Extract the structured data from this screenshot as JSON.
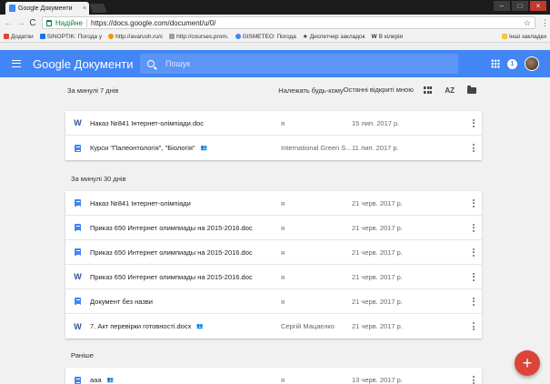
{
  "browser": {
    "tab_title": "Google Документи",
    "tab_close": "×",
    "window_controls": [
      "–",
      "□",
      "×"
    ],
    "nav": {
      "back": "←",
      "forward": "→",
      "reload": "C"
    },
    "secure_label": "Надійне",
    "url": "https://docs.google.com/document/u/0/",
    "star": "☆",
    "menu": "⋮",
    "bookmarks": [
      {
        "label": "Додатки",
        "color": "#e94235"
      },
      {
        "label": "SINOPTIK: Погода у",
        "color": "#1a73e8"
      },
      {
        "label": "http://avarush.ru/c",
        "color": "#f29900"
      },
      {
        "label": "http://courses.prom.",
        "color": "#9aa0a6"
      },
      {
        "label": "GISMETEO: Погода",
        "color": "#4285f4"
      },
      {
        "label": "Диспетчер закладок",
        "color": "#202124"
      },
      {
        "label": "В кілерія",
        "color": "#202124"
      }
    ],
    "bookmarks_right": "Інші закладки"
  },
  "app": {
    "brand": "Google Документи",
    "search_placeholder": "Пошук",
    "notification_count": "1"
  },
  "list_header": {
    "period": "За минулі 7 днів",
    "owner": "Належать будь-кому",
    "opened": "Останні відкриті мною",
    "sort": "AZ"
  },
  "sections": [
    {
      "label": "",
      "rows": [
        {
          "type": "word",
          "name": "Наказ №841 Інтернет-олімпіади.doc",
          "shared": false,
          "owner": "я",
          "date": "15 лип. 2017 р."
        },
        {
          "type": "doc",
          "name": "Курси \"Палеонтологія\", \"Біологія\"",
          "shared": true,
          "owner": "International Green S...",
          "date": "11 лип. 2017 р."
        }
      ]
    },
    {
      "label": "За минулі 30 днів",
      "rows": [
        {
          "type": "doc",
          "name": "Наказ №841 Інтернет-олімпіади",
          "shared": false,
          "owner": "я",
          "date": "21 черв. 2017 р."
        },
        {
          "type": "doc",
          "name": "Приказ 650 Интернет олимпиады на 2015-2016.doc",
          "shared": false,
          "owner": "я",
          "date": "21 черв. 2017 р."
        },
        {
          "type": "doc",
          "name": "Приказ 650 Интернет олимпиады на 2015-2016.doc",
          "shared": false,
          "owner": "я",
          "date": "21 черв. 2017 р."
        },
        {
          "type": "word",
          "name": "Приказ 650 Интернет олимпиады на 2015-2016.doc",
          "shared": false,
          "owner": "я",
          "date": "21 черв. 2017 р."
        },
        {
          "type": "doc",
          "name": "Документ без назви",
          "shared": false,
          "owner": "я",
          "date": "21 черв. 2017 р."
        },
        {
          "type": "word",
          "name": "7. Акт перевірки готовності.docx",
          "shared": true,
          "owner": "Сергій Мацаєнко",
          "date": "21 черв. 2017 р."
        }
      ]
    },
    {
      "label": "Раніше",
      "rows": [
        {
          "type": "doc",
          "name": "ааа",
          "shared": true,
          "owner": "я",
          "date": "13 черв. 2017 р."
        }
      ]
    }
  ],
  "fab": "+",
  "colors": {
    "accent": "#4285f4",
    "fab": "#db4437",
    "word": "#2b579a"
  }
}
